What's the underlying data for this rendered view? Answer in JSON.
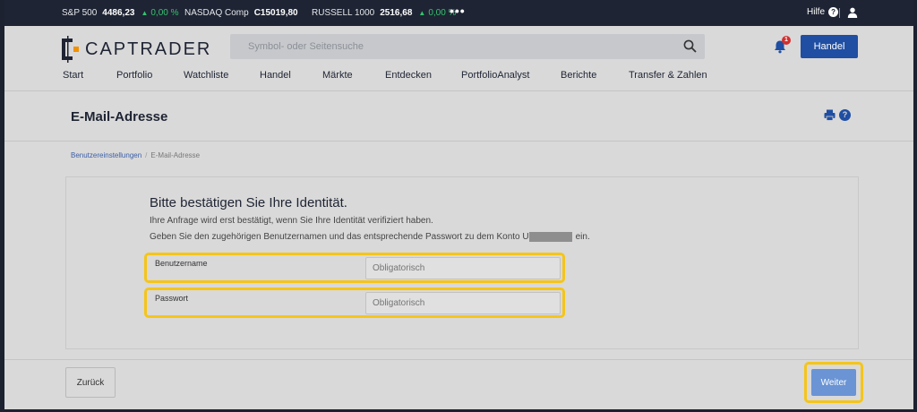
{
  "ticker": {
    "items": [
      {
        "name": "S&P 500",
        "value": "4486,23",
        "change": "0,00 %"
      },
      {
        "name": "NASDAQ Comp",
        "value": "C15019,80",
        "change": ""
      },
      {
        "name": "RUSSELL 1000",
        "value": "2516,68",
        "change": "0,00 %"
      }
    ],
    "more_label": "•••",
    "help_label": "Hilfe"
  },
  "header": {
    "logo_text": "CAPTRADER",
    "search_placeholder": "Symbol- oder Seitensuche",
    "notification_count": "1",
    "trade_button_label": "Handel"
  },
  "nav": {
    "items": [
      "Start",
      "Portfolio",
      "Watchliste",
      "Handel",
      "Märkte",
      "Entdecken",
      "PortfolioAnalyst",
      "Berichte",
      "Transfer & Zahlen"
    ]
  },
  "page": {
    "title": "E-Mail-Adresse",
    "breadcrumb": [
      "Benutzereinstellungen",
      "E-Mail-Adresse"
    ]
  },
  "form": {
    "heading": "Bitte bestätigen Sie Ihre Identität.",
    "line1": "Ihre Anfrage wird erst bestätigt, wenn Sie Ihre Identität verifiziert haben.",
    "line2_before": "Geben Sie den zugehörigen Benutzernamen und das entsprechende Passwort zu dem Konto U",
    "line2_after": "ein.",
    "username_label": "Benutzername",
    "username_placeholder": "Obligatorisch",
    "password_label": "Passwort",
    "password_placeholder": "Obligatorisch",
    "back_label": "Zurück",
    "next_label": "Weiter"
  },
  "colors": {
    "accent": "#1f4ea3",
    "highlight": "#f5c518",
    "positive": "#37c26f",
    "topbar": "#1e2433"
  }
}
